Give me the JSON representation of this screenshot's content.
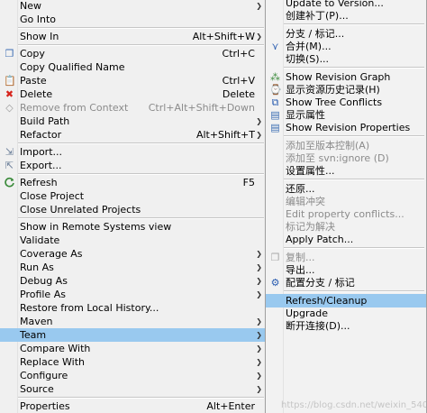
{
  "main_menu": [
    {
      "label": "New",
      "accel": "",
      "submenu": true,
      "disabled": false,
      "icon": ""
    },
    {
      "label": "Go Into",
      "accel": "",
      "submenu": false,
      "disabled": false,
      "icon": ""
    },
    {
      "sep": true
    },
    {
      "label": "Show In",
      "accel": "Alt+Shift+W",
      "submenu": true,
      "disabled": false,
      "icon": ""
    },
    {
      "sep": true
    },
    {
      "label": "Copy",
      "accel": "Ctrl+C",
      "submenu": false,
      "disabled": false,
      "icon": "copy-icon"
    },
    {
      "label": "Copy Qualified Name",
      "accel": "",
      "submenu": false,
      "disabled": false,
      "icon": ""
    },
    {
      "label": "Paste",
      "accel": "Ctrl+V",
      "submenu": false,
      "disabled": false,
      "icon": "paste-icon"
    },
    {
      "label": "Delete",
      "accel": "Delete",
      "submenu": false,
      "disabled": false,
      "icon": "delete-icon"
    },
    {
      "label": "Remove from Context",
      "accel": "Ctrl+Alt+Shift+Down",
      "submenu": false,
      "disabled": true,
      "icon": "remove-context-icon"
    },
    {
      "label": "Build Path",
      "accel": "",
      "submenu": true,
      "disabled": false,
      "icon": ""
    },
    {
      "label": "Refactor",
      "accel": "Alt+Shift+T",
      "submenu": true,
      "disabled": false,
      "icon": ""
    },
    {
      "sep": true
    },
    {
      "label": "Import...",
      "accel": "",
      "submenu": false,
      "disabled": false,
      "icon": "import-icon"
    },
    {
      "label": "Export...",
      "accel": "",
      "submenu": false,
      "disabled": false,
      "icon": "export-icon"
    },
    {
      "sep": true
    },
    {
      "label": "Refresh",
      "accel": "F5",
      "submenu": false,
      "disabled": false,
      "icon": "refresh-icon"
    },
    {
      "label": "Close Project",
      "accel": "",
      "submenu": false,
      "disabled": false,
      "icon": ""
    },
    {
      "label": "Close Unrelated Projects",
      "accel": "",
      "submenu": false,
      "disabled": false,
      "icon": ""
    },
    {
      "sep": true
    },
    {
      "label": "Show in Remote Systems view",
      "accel": "",
      "submenu": false,
      "disabled": false,
      "icon": ""
    },
    {
      "label": "Validate",
      "accel": "",
      "submenu": false,
      "disabled": false,
      "icon": ""
    },
    {
      "label": "Coverage As",
      "accel": "",
      "submenu": true,
      "disabled": false,
      "icon": ""
    },
    {
      "label": "Run As",
      "accel": "",
      "submenu": true,
      "disabled": false,
      "icon": ""
    },
    {
      "label": "Debug As",
      "accel": "",
      "submenu": true,
      "disabled": false,
      "icon": ""
    },
    {
      "label": "Profile As",
      "accel": "",
      "submenu": true,
      "disabled": false,
      "icon": ""
    },
    {
      "label": "Restore from Local History...",
      "accel": "",
      "submenu": false,
      "disabled": false,
      "icon": ""
    },
    {
      "label": "Maven",
      "accel": "",
      "submenu": true,
      "disabled": false,
      "icon": ""
    },
    {
      "label": "Team",
      "accel": "",
      "submenu": true,
      "disabled": false,
      "icon": "",
      "highlighted": true
    },
    {
      "label": "Compare With",
      "accel": "",
      "submenu": true,
      "disabled": false,
      "icon": ""
    },
    {
      "label": "Replace With",
      "accel": "",
      "submenu": true,
      "disabled": false,
      "icon": ""
    },
    {
      "label": "Configure",
      "accel": "",
      "submenu": true,
      "disabled": false,
      "icon": ""
    },
    {
      "label": "Source",
      "accel": "",
      "submenu": true,
      "disabled": false,
      "icon": ""
    },
    {
      "sep": true
    },
    {
      "label": "Properties",
      "accel": "Alt+Enter",
      "submenu": false,
      "disabled": false,
      "icon": ""
    }
  ],
  "team_menu": [
    {
      "label": "Update to Version...",
      "disabled": false,
      "icon": ""
    },
    {
      "label": "创建补丁(P)...",
      "disabled": false,
      "icon": ""
    },
    {
      "sep": true
    },
    {
      "label": "分支 / 标记...",
      "disabled": false,
      "icon": ""
    },
    {
      "label": "合并(M)...",
      "disabled": false,
      "icon": "merge-icon"
    },
    {
      "label": "切换(S)...",
      "disabled": false,
      "icon": ""
    },
    {
      "sep": true
    },
    {
      "label": "Show Revision Graph",
      "disabled": false,
      "icon": "revision-graph-icon"
    },
    {
      "label": "显示资源历史记录(H)",
      "disabled": false,
      "icon": "history-icon"
    },
    {
      "label": "Show Tree Conflicts",
      "disabled": false,
      "icon": "tree-conflicts-icon"
    },
    {
      "label": "显示属性",
      "disabled": false,
      "icon": "properties-icon"
    },
    {
      "label": "Show Revision Properties",
      "disabled": false,
      "icon": "revision-properties-icon"
    },
    {
      "sep": true
    },
    {
      "label": "添加至版本控制(A)",
      "disabled": true,
      "icon": ""
    },
    {
      "label": "添加至 svn:ignore (D)",
      "disabled": true,
      "icon": ""
    },
    {
      "label": "设置属性...",
      "disabled": false,
      "icon": ""
    },
    {
      "sep": true
    },
    {
      "label": "还原...",
      "disabled": false,
      "icon": ""
    },
    {
      "label": "编辑冲突",
      "disabled": true,
      "icon": ""
    },
    {
      "label": "Edit property conflicts...",
      "disabled": true,
      "icon": ""
    },
    {
      "label": "标记为解决",
      "disabled": true,
      "icon": ""
    },
    {
      "label": "Apply Patch...",
      "disabled": false,
      "icon": ""
    },
    {
      "sep": true
    },
    {
      "label": "复制...",
      "disabled": true,
      "icon": "copy-disabled-icon"
    },
    {
      "label": "导出...",
      "disabled": false,
      "icon": ""
    },
    {
      "label": "配置分支 / 标记",
      "disabled": false,
      "icon": "branch-config-icon"
    },
    {
      "sep": true
    },
    {
      "label": "Refresh/Cleanup",
      "disabled": false,
      "icon": "",
      "highlighted": true
    },
    {
      "label": "Upgrade",
      "disabled": false,
      "icon": ""
    },
    {
      "label": "断开连接(D)...",
      "disabled": false,
      "icon": ""
    }
  ],
  "watermark": "https://blog.csdn.net/weixin_54012945",
  "colors": {
    "highlight": "#99c9ef",
    "menu_bg": "#f0f0f0",
    "disabled": "#8b8b8b",
    "delete_red": "#d6241c"
  }
}
